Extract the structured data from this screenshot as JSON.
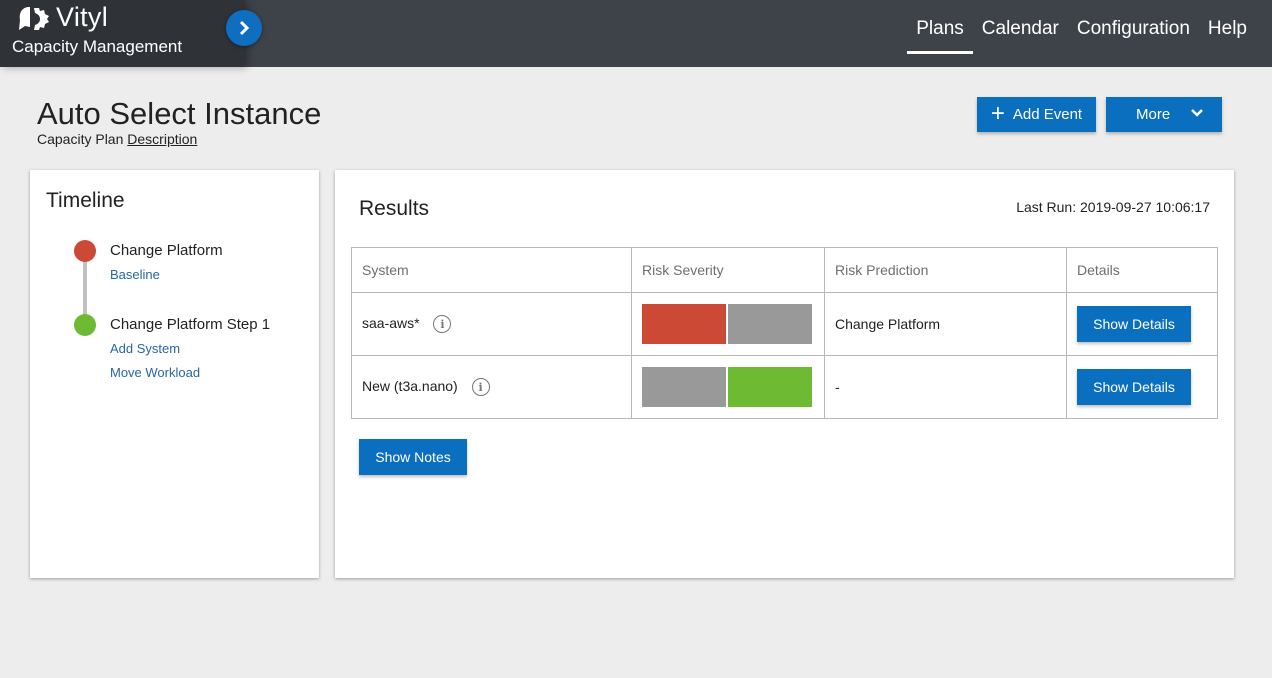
{
  "brand": {
    "name": "Vityl",
    "subtitle": "Capacity Management",
    "logo_icon": "vityl-logo-icon",
    "expand_icon": "chevron-right-icon"
  },
  "nav": {
    "items": [
      {
        "label": "Plans",
        "active": true
      },
      {
        "label": "Calendar",
        "active": false
      },
      {
        "label": "Configuration",
        "active": false
      },
      {
        "label": "Help",
        "active": false
      }
    ]
  },
  "page": {
    "title": "Auto Select Instance",
    "subtitle_prefix": "Capacity Plan",
    "subtitle_link": "Description"
  },
  "actions": {
    "add_event": "Add Event",
    "add_icon": "plus-icon",
    "more": "More",
    "more_icon": "chevron-down-icon"
  },
  "timeline": {
    "title": "Timeline",
    "events": [
      {
        "title": "Change Platform",
        "status_color": "#cc4a35",
        "links": [
          "Baseline"
        ]
      },
      {
        "title": "Change Platform Step 1",
        "status_color": "#6fba33",
        "links": [
          "Add System",
          "Move Workload"
        ]
      }
    ]
  },
  "results": {
    "title": "Results",
    "last_run": "Last Run: 2019-09-27 10:06:17",
    "columns": [
      "System",
      "Risk Severity",
      "Risk Prediction",
      "Details"
    ],
    "rows": [
      {
        "system": "saa-aws*",
        "severity": [
          "#cc4a35",
          "#999999"
        ],
        "prediction": "Change Platform",
        "details_label": "Show Details"
      },
      {
        "system": "New (t3a.nano)",
        "severity": [
          "#999999",
          "#6fba33"
        ],
        "prediction": "-",
        "details_label": "Show Details"
      }
    ],
    "show_notes": "Show Notes"
  },
  "colors": {
    "accent": "#0b6fbf",
    "header": "#3e4349",
    "danger": "#cc4a35",
    "ok": "#6fba33",
    "neutral": "#999999"
  }
}
